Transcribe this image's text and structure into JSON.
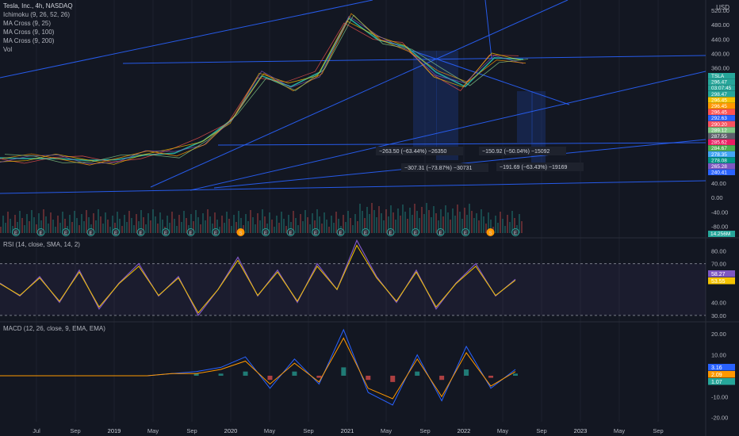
{
  "legend": {
    "title": "Tesla, Inc., 4h, NASDAQ",
    "indicators": [
      "Ichimoku (9, 26, 52, 26)",
      "MA Cross (9, 25)",
      "MA Cross (9, 100)",
      "MA Cross (9, 200)",
      "Vol"
    ]
  },
  "currency": "USD",
  "rsi_title": "RSI (14, close, SMA, 14, 2)",
  "macd_title": "MACD (12, 26, close, 9, EMA, EMA)",
  "chart_data": [
    {
      "type": "line",
      "title": "Tesla, Inc., 4h, NASDAQ",
      "x": [
        "2018-06",
        "2018-09",
        "2019-01",
        "2019-05",
        "2019-09",
        "2020-01",
        "2020-03",
        "2020-06",
        "2020-09",
        "2021-01",
        "2021-05",
        "2021-09",
        "2021-11",
        "2022-01",
        "2022-03",
        "2022-05",
        "2022-06",
        "2022-08",
        "2022-09"
      ],
      "series": [
        {
          "name": "TSLA",
          "values": [
            22,
            20,
            20,
            15,
            17,
            30,
            35,
            70,
            130,
            250,
            220,
            260,
            410,
            350,
            330,
            260,
            220,
            300,
            296
          ]
        }
      ],
      "xticks": [
        "Jul",
        "Sep",
        "2019",
        "May",
        "Sep",
        "2020",
        "May",
        "Sep",
        "2021",
        "May",
        "Sep",
        "2022",
        "May",
        "Sep",
        "2023",
        "May",
        "Sep"
      ],
      "yticks": [
        520,
        480,
        440,
        400,
        360,
        320,
        -40,
        -80
      ],
      "yticks_extra": [
        40,
        0
      ],
      "price_labels": [
        {
          "text": "TSLA",
          "color": "#26a69a"
        },
        {
          "text": "296.47",
          "color": "#26a69a"
        },
        {
          "text": "03:07:45",
          "color": "#26a69a"
        },
        {
          "text": "298.47",
          "color": "#26a69a"
        },
        {
          "text": "296.45",
          "color": "#f5c400"
        },
        {
          "text": "296.45",
          "color": "#ff9800"
        },
        {
          "text": "296.45",
          "color": "#ff5252"
        },
        {
          "text": "292.63",
          "color": "#2962ff"
        },
        {
          "text": "290.20",
          "color": "#f7525f"
        },
        {
          "text": "289.12",
          "color": "#81c784"
        },
        {
          "text": "287.55",
          "color": "#5d606b"
        },
        {
          "text": "285.62",
          "color": "#e91e63"
        },
        {
          "text": "284.67",
          "color": "#4caf50"
        },
        {
          "text": "278.35",
          "color": "#42a5f5"
        },
        {
          "text": "278.08",
          "color": "#009688"
        },
        {
          "text": "265.28",
          "color": "#7e57c2"
        },
        {
          "text": "240.41",
          "color": "#2962ff"
        }
      ],
      "volume_label": "14.256M",
      "annotations": [
        "−263.50 (−63.44%) −26350",
        "−307.31 (−73.87%) −30731",
        "−150.92 (−50.04%) −15092",
        "−191.69 (−63.43%) −19169"
      ],
      "event_markers": [
        "E",
        "E",
        "E",
        "E",
        "E",
        "E",
        "E",
        "E",
        "E",
        "S",
        "E",
        "E",
        "E",
        "E",
        "E",
        "E",
        "E",
        "E",
        "E",
        "S",
        "E"
      ]
    },
    {
      "type": "line",
      "title": "RSI (14, close, SMA, 14, 2)",
      "ylim": [
        25,
        90
      ],
      "yticks": [
        80.0,
        70.0,
        40.0,
        30.0
      ],
      "bands": [
        70,
        30
      ],
      "series": [
        {
          "name": "RSI",
          "values": [
            55,
            45,
            60,
            40,
            65,
            35,
            55,
            70,
            45,
            60,
            30,
            50,
            75,
            45,
            65,
            40,
            70,
            50,
            88,
            60,
            40,
            65,
            35,
            55,
            70,
            45,
            58
          ]
        }
      ],
      "value_labels": [
        {
          "text": "58.27",
          "color": "#7e57c2"
        },
        {
          "text": "53.55",
          "color": "#f5c400"
        }
      ]
    },
    {
      "type": "line",
      "title": "MACD (12, 26, close, 9, EMA, EMA)",
      "ylim": [
        -22,
        25
      ],
      "yticks": [
        20.0,
        10.0,
        -10.0,
        -20.0
      ],
      "series": [
        {
          "name": "MACD",
          "values": [
            0,
            0,
            0,
            0,
            0,
            0,
            0,
            1,
            2,
            4,
            9,
            -6,
            8,
            -4,
            22,
            -8,
            -14,
            10,
            -12,
            14,
            -6,
            3
          ]
        },
        {
          "name": "Signal",
          "values": [
            0,
            0,
            0,
            0,
            0,
            0,
            0,
            1,
            1,
            3,
            7,
            -4,
            6,
            -3,
            18,
            -6,
            -11,
            8,
            -10,
            11,
            -5,
            2
          ]
        }
      ],
      "value_labels": [
        {
          "text": "3.16",
          "color": "#2962ff"
        },
        {
          "text": "2.09",
          "color": "#ff9800"
        },
        {
          "text": "1.07",
          "color": "#26a69a"
        }
      ]
    }
  ]
}
